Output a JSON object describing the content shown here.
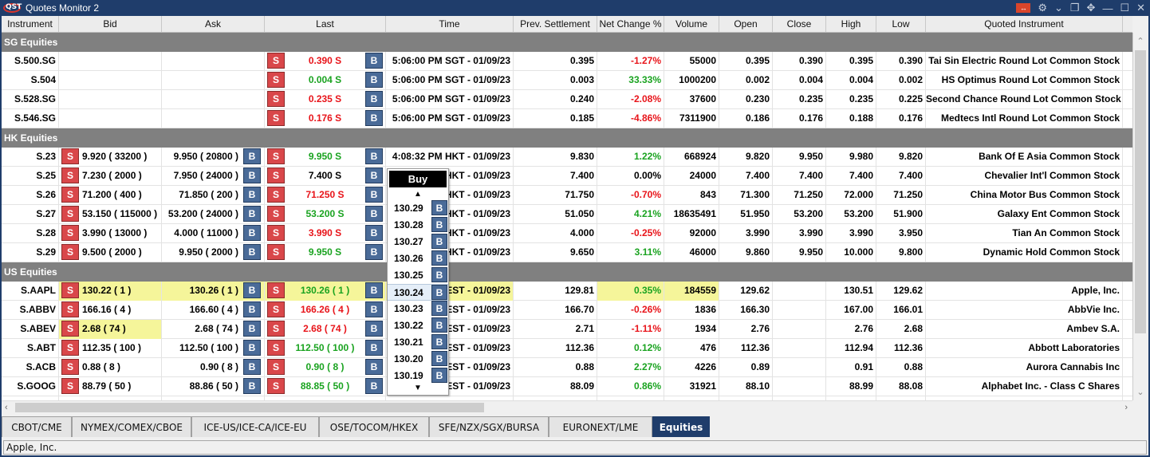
{
  "window": {
    "title": "Quotes Monitor 2",
    "logo": "QST",
    "controls": [
      "link-icon",
      "gear-icon",
      "chevron-down-icon",
      "restore-icon",
      "move-icon",
      "minimize-icon",
      "maximize-icon",
      "close-icon"
    ]
  },
  "columns": [
    "Instrument",
    "Bid",
    "Ask",
    "Last",
    "Time",
    "Prev. Settlement",
    "Net Change %",
    "Volume",
    "Open",
    "Close",
    "High",
    "Low",
    "Quoted Instrument"
  ],
  "buttons": {
    "sell": "S",
    "buy": "B"
  },
  "groups": [
    {
      "name": "SG Equities",
      "rows": [
        {
          "instrument": "S.500.SG",
          "bid": "",
          "ask": "",
          "last": "0.390 S",
          "last_color": "red",
          "time": "5:06:00 PM SGT - 01/09/23",
          "prev": "0.395",
          "chg": "-1.27%",
          "chg_color": "red",
          "vol": "55000",
          "open": "0.395",
          "close": "0.390",
          "high": "0.395",
          "low": "0.390",
          "quoted": "Tai Sin Electric Round Lot Common Stock"
        },
        {
          "instrument": "S.504",
          "bid": "",
          "ask": "",
          "last": "0.004 S",
          "last_color": "green",
          "time": "5:06:00 PM SGT - 01/09/23",
          "prev": "0.003",
          "chg": "33.33%",
          "chg_color": "green",
          "vol": "1000200",
          "open": "0.002",
          "close": "0.004",
          "high": "0.004",
          "low": "0.002",
          "quoted": "HS Optimus Round Lot Common Stock"
        },
        {
          "instrument": "S.528.SG",
          "bid": "",
          "ask": "",
          "last": "0.235 S",
          "last_color": "red",
          "time": "5:06:00 PM SGT - 01/09/23",
          "prev": "0.240",
          "chg": "-2.08%",
          "chg_color": "red",
          "vol": "37600",
          "open": "0.230",
          "close": "0.235",
          "high": "0.235",
          "low": "0.225",
          "quoted": "Second Chance Round Lot Common Stock"
        },
        {
          "instrument": "S.546.SG",
          "bid": "",
          "ask": "",
          "last": "0.176 S",
          "last_color": "red",
          "time": "5:06:00 PM SGT - 01/09/23",
          "prev": "0.185",
          "chg": "-4.86%",
          "chg_color": "red",
          "vol": "7311900",
          "open": "0.186",
          "close": "0.176",
          "high": "0.188",
          "low": "0.176",
          "quoted": "Medtecs Intl Round Lot Common Stock"
        }
      ]
    },
    {
      "name": "HK Equities",
      "rows": [
        {
          "instrument": "S.23",
          "bid": "9.920 ( 33200 )",
          "ask": "9.950 ( 20800 )",
          "last": "9.950 S",
          "last_color": "green",
          "time": "4:08:32 PM HKT - 01/09/23",
          "prev": "9.830",
          "chg": "1.22%",
          "chg_color": "green",
          "vol": "668924",
          "open": "9.820",
          "close": "9.950",
          "high": "9.980",
          "low": "9.820",
          "quoted": "Bank Of E Asia Common Stock"
        },
        {
          "instrument": "S.25",
          "bid": "7.230 ( 2000 )",
          "ask": "7.950 ( 24000 )",
          "last": "7.400 S",
          "last_color": "black",
          "time": "HKT - 01/09/23",
          "prev": "7.400",
          "chg": "0.00%",
          "chg_color": "black",
          "vol": "24000",
          "open": "7.400",
          "close": "7.400",
          "high": "7.400",
          "low": "7.400",
          "quoted": "Chevalier Int'l Common Stock"
        },
        {
          "instrument": "S.26",
          "bid": "71.200 ( 400 )",
          "ask": "71.850 ( 200 )",
          "last": "71.250 S",
          "last_color": "red",
          "time": "HKT - 01/09/23",
          "prev": "71.750",
          "chg": "-0.70%",
          "chg_color": "red",
          "vol": "843",
          "open": "71.300",
          "close": "71.250",
          "high": "72.000",
          "low": "71.250",
          "quoted": "China Motor Bus Common Stock"
        },
        {
          "instrument": "S.27",
          "bid": "53.150 ( 115000 )",
          "ask": "53.200 ( 24000 )",
          "last": "53.200 S",
          "last_color": "green",
          "time": "HKT - 01/09/23",
          "prev": "51.050",
          "chg": "4.21%",
          "chg_color": "green",
          "vol": "18635491",
          "open": "51.950",
          "close": "53.200",
          "high": "53.200",
          "low": "51.900",
          "quoted": "Galaxy Ent Common Stock"
        },
        {
          "instrument": "S.28",
          "bid": "3.990 ( 13000 )",
          "ask": "4.000 ( 11000 )",
          "last": "3.990 S",
          "last_color": "red",
          "time": "HKT - 01/09/23",
          "prev": "4.000",
          "chg": "-0.25%",
          "chg_color": "red",
          "vol": "92000",
          "open": "3.990",
          "close": "3.990",
          "high": "3.990",
          "low": "3.950",
          "quoted": "Tian An Common Stock"
        },
        {
          "instrument": "S.29",
          "bid": "9.500 ( 2000 )",
          "ask": "9.950 ( 2000 )",
          "last": "9.950 S",
          "last_color": "green",
          "time": "HKT - 01/09/23",
          "prev": "9.650",
          "chg": "3.11%",
          "chg_color": "green",
          "vol": "46000",
          "open": "9.860",
          "close": "9.950",
          "high": "10.000",
          "low": "9.800",
          "quoted": "Dynamic Hold Common Stock"
        }
      ]
    },
    {
      "name": "US Equities",
      "rows": [
        {
          "instrument": "S.AAPL",
          "bid": "130.22 ( 1 )",
          "ask": "130.26 ( 1 )",
          "last": "130.26 ( 1 )",
          "last_color": "green",
          "time": "EST - 01/09/23",
          "prev": "129.81",
          "chg": "0.35%",
          "chg_color": "green",
          "vol": "184559",
          "open": "129.62",
          "close": "",
          "high": "130.51",
          "low": "129.62",
          "quoted": "Apple, Inc.",
          "highlight": [
            "bid",
            "ask",
            "last",
            "time",
            "chg",
            "vol"
          ]
        },
        {
          "instrument": "S.ABBV",
          "bid": "166.16 ( 4 )",
          "ask": "166.60 ( 4 )",
          "last": "166.26 ( 4 )",
          "last_color": "red",
          "time": "EST - 01/09/23",
          "prev": "166.70",
          "chg": "-0.26%",
          "chg_color": "red",
          "vol": "1836",
          "open": "166.30",
          "close": "",
          "high": "167.00",
          "low": "166.01",
          "quoted": "AbbVie Inc."
        },
        {
          "instrument": "S.ABEV",
          "bid": "2.68 ( 74 )",
          "ask": "2.68 ( 74 )",
          "last": "2.68 ( 74 )",
          "last_color": "red",
          "time": "EST - 01/09/23",
          "prev": "2.71",
          "chg": "-1.11%",
          "chg_color": "red",
          "vol": "1934",
          "open": "2.76",
          "close": "",
          "high": "2.76",
          "low": "2.68",
          "quoted": "Ambev S.A.",
          "highlight": [
            "bid"
          ]
        },
        {
          "instrument": "S.ABT",
          "bid": "112.35 ( 100 )",
          "ask": "112.50 ( 100 )",
          "last": "112.50 ( 100 )",
          "last_color": "green",
          "time": "EST - 01/09/23",
          "prev": "112.36",
          "chg": "0.12%",
          "chg_color": "green",
          "vol": "476",
          "open": "112.36",
          "close": "",
          "high": "112.94",
          "low": "112.36",
          "quoted": "Abbott Laboratories"
        },
        {
          "instrument": "S.ACB",
          "bid": "0.88 ( 8 )",
          "ask": "0.90 ( 8 )",
          "last": "0.90 ( 8 )",
          "last_color": "green",
          "time": "EST - 01/09/23",
          "prev": "0.88",
          "chg": "2.27%",
          "chg_color": "green",
          "vol": "4226",
          "open": "0.89",
          "close": "",
          "high": "0.91",
          "low": "0.88",
          "quoted": "Aurora Cannabis Inc"
        },
        {
          "instrument": "S.GOOG",
          "bid": "88.79 ( 50 )",
          "ask": "88.86 ( 50 )",
          "last": "88.85 ( 50 )",
          "last_color": "green",
          "time": "EST - 01/09/23",
          "prev": "88.09",
          "chg": "0.86%",
          "chg_color": "green",
          "vol": "31921",
          "open": "88.10",
          "close": "",
          "high": "88.99",
          "low": "88.08",
          "quoted": "Alphabet Inc. - Class C Shares"
        }
      ]
    }
  ],
  "buy_popup": {
    "title": "Buy",
    "prices": [
      "130.29",
      "130.28",
      "130.27",
      "130.26",
      "130.25",
      "130.24",
      "130.23",
      "130.22",
      "130.21",
      "130.20",
      "130.19"
    ],
    "selected": "130.24"
  },
  "tabs": [
    {
      "label": "CBOT/CME",
      "active": false
    },
    {
      "label": "NYMEX/COMEX/CBOE",
      "active": false
    },
    {
      "label": "ICE-US/ICE-CA/ICE-EU",
      "active": false
    },
    {
      "label": "OSE/TOCOM/HKEX",
      "active": false
    },
    {
      "label": "SFE/NZX/SGX/BURSA",
      "active": false
    },
    {
      "label": "EURONEXT/LME",
      "active": false
    },
    {
      "label": "Equities",
      "active": true
    }
  ],
  "status_bar": "Apple, Inc.",
  "colors": {
    "red": "#e8141a",
    "green": "#1aa320",
    "black": "#000000",
    "active_tab": "#1f3d6b",
    "sell": "#d9474a",
    "buy": "#4a6b98",
    "highlight": "#f5f59a"
  }
}
